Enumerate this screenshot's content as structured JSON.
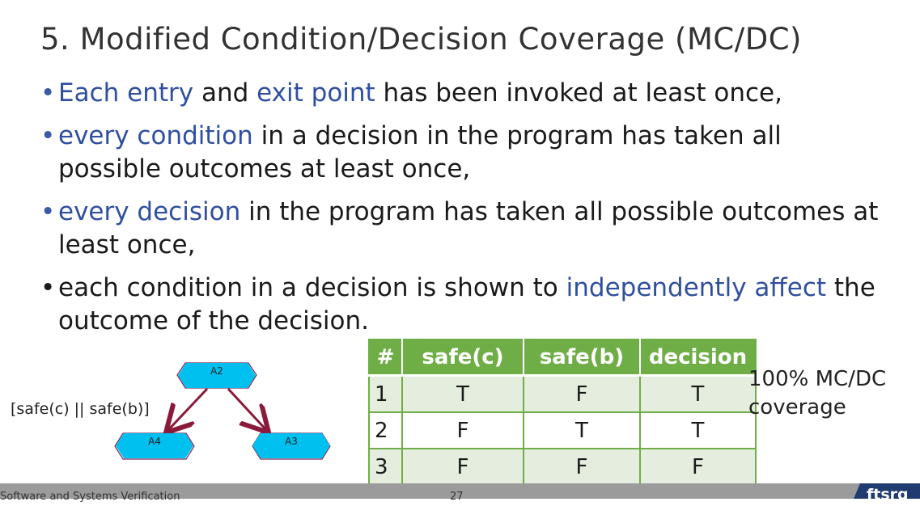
{
  "slide": {
    "title": "5. Modified Condition/Decision Coverage (MC/DC)",
    "bullets": [
      {
        "parts": [
          {
            "text": "Each entry",
            "hl": true
          },
          {
            "text": " and ",
            "hl": false
          },
          {
            "text": "exit point",
            "hl": true
          },
          {
            "text": " has been invoked at least once,",
            "hl": false
          }
        ]
      },
      {
        "parts": [
          {
            "text": "every condition",
            "hl": true
          },
          {
            "text": " in a decision in the program has taken all possible outcomes at least once,",
            "hl": false
          }
        ]
      },
      {
        "parts": [
          {
            "text": "every decision",
            "hl": true
          },
          {
            "text": " in the program has taken all possible outcomes at least once,",
            "hl": false
          }
        ]
      },
      {
        "parts": [
          {
            "text": "each condition in a decision is shown to ",
            "hl": false
          },
          {
            "text": "independently affect",
            "hl": true
          },
          {
            "text": " the outcome of the decision.",
            "hl": false
          }
        ]
      }
    ]
  },
  "diagram": {
    "nodes": {
      "top": "A2",
      "left": "A4",
      "right": "A3"
    },
    "guard": "[safe(c) || safe(b)]",
    "colors": {
      "node_fill": "#00c0f0",
      "arrow": "#8b1a3a"
    }
  },
  "table": {
    "headers": [
      "#",
      "safe(c)",
      "safe(b)",
      "decision"
    ],
    "rows": [
      [
        "1",
        "T",
        "F",
        "T"
      ],
      [
        "2",
        "F",
        "T",
        "T"
      ],
      [
        "3",
        "F",
        "F",
        "F"
      ]
    ],
    "colors": {
      "header_bg": "#6fae46",
      "stripe": "#e4edde"
    }
  },
  "coverage_note": {
    "line1": "100% MC/DC",
    "line2": "coverage"
  },
  "footer": {
    "course": "Software and Systems Verification",
    "page": "27",
    "logo": "ftsrg"
  }
}
